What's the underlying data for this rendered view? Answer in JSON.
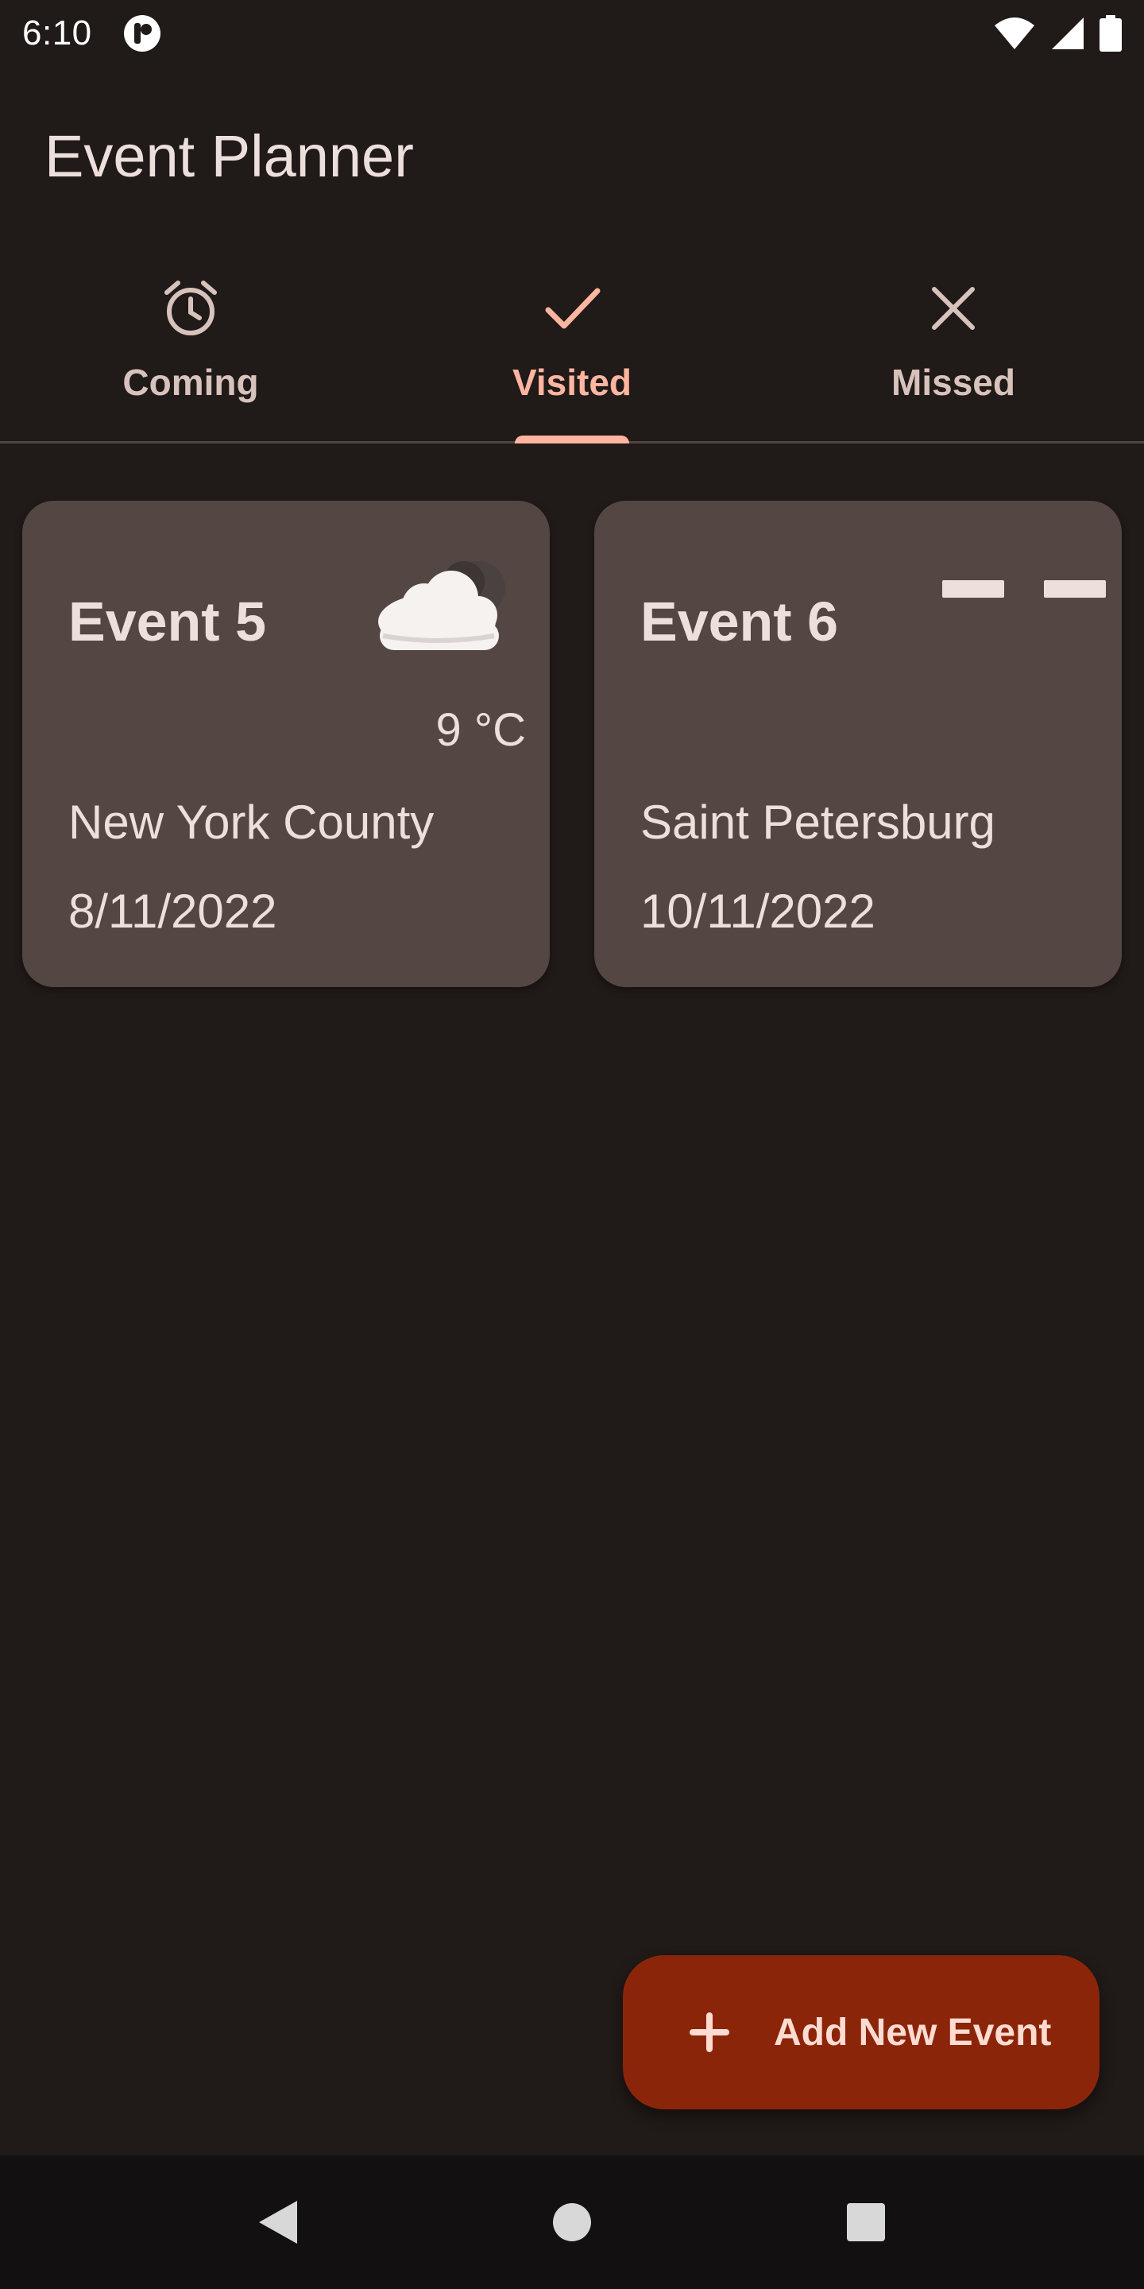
{
  "status_bar": {
    "time": "6:10",
    "icons": [
      "app-notification-icon",
      "wifi-icon",
      "signal-icon",
      "battery-icon"
    ]
  },
  "app_bar": {
    "title": "Event Planner"
  },
  "tabs": [
    {
      "label": "Coming",
      "icon": "alarm-clock-icon",
      "active": false
    },
    {
      "label": "Visited",
      "icon": "check-icon",
      "active": true
    },
    {
      "label": "Missed",
      "icon": "close-icon",
      "active": false
    }
  ],
  "events": [
    {
      "title": "Event 5",
      "weather_icon": "cloudy-night-icon",
      "temperature": "9 °C",
      "location": "New York County",
      "date": "8/11/2022"
    },
    {
      "title": "Event 6",
      "weather_icon": "no-data-dashes",
      "temperature": "",
      "location": "Saint Petersburg",
      "date": "10/11/2022"
    }
  ],
  "fab": {
    "icon": "plus-icon",
    "label": "Add New Event"
  },
  "nav_bar": {
    "buttons": [
      "back-icon",
      "home-icon",
      "recents-icon"
    ]
  },
  "colors": {
    "background": "#201a18",
    "card": "#534643",
    "accent": "#ffb5a0",
    "fab": "#8b2509",
    "fab_text": "#ffdbd1",
    "text": "#ede0dc"
  }
}
